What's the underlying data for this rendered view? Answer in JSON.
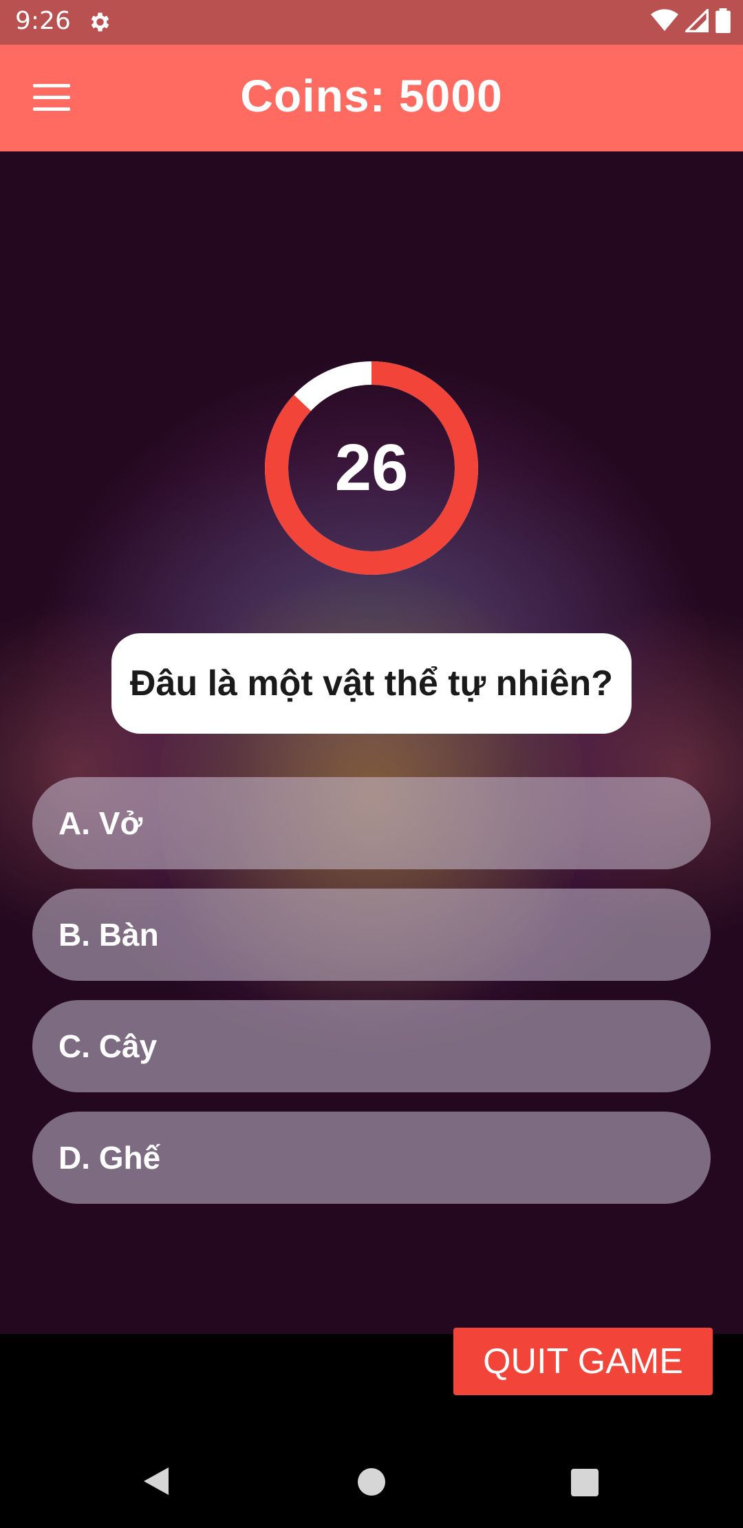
{
  "status_bar": {
    "time": "9:26",
    "icons": [
      "settings-icon",
      "wifi-icon",
      "signal-icon",
      "battery-icon"
    ]
  },
  "app_bar": {
    "title": "Coins: 5000",
    "menu_icon": "hamburger-menu-icon",
    "color": "#ff6a61"
  },
  "timer": {
    "seconds": "26",
    "progress_fraction": 0.87,
    "ring_color": "#f24438",
    "track_color": "#ffffff"
  },
  "question": {
    "text": "Đâu là một vật thể tự nhiên?"
  },
  "answers": [
    {
      "label": "A. Vở"
    },
    {
      "label": "B. Bàn"
    },
    {
      "label": "C. Cây"
    },
    {
      "label": "D. Ghế"
    }
  ],
  "quit_button": {
    "label": "QUIT GAME",
    "color": "#f24438"
  },
  "nav_bar": {
    "icons": [
      "back-icon",
      "home-icon",
      "recents-icon"
    ]
  }
}
